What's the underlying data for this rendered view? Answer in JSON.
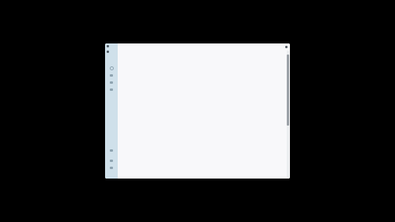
{
  "window": {
    "title": ""
  },
  "sidebar": {
    "top_icons": [
      "window-control-icon",
      "window-control-icon"
    ],
    "nav_icons": [
      "home-icon",
      "grid-icon",
      "list-icon",
      "tag-icon"
    ],
    "bottom_icons": [
      "settings-icon",
      "user-icon",
      "help-icon"
    ]
  },
  "content": {
    "menu_icon": "more-icon"
  },
  "colors": {
    "background": "#000000",
    "window": "#f8f8f9",
    "sidebar": "#cfe0ea",
    "scroll_thumb": "#9aa0a6"
  }
}
